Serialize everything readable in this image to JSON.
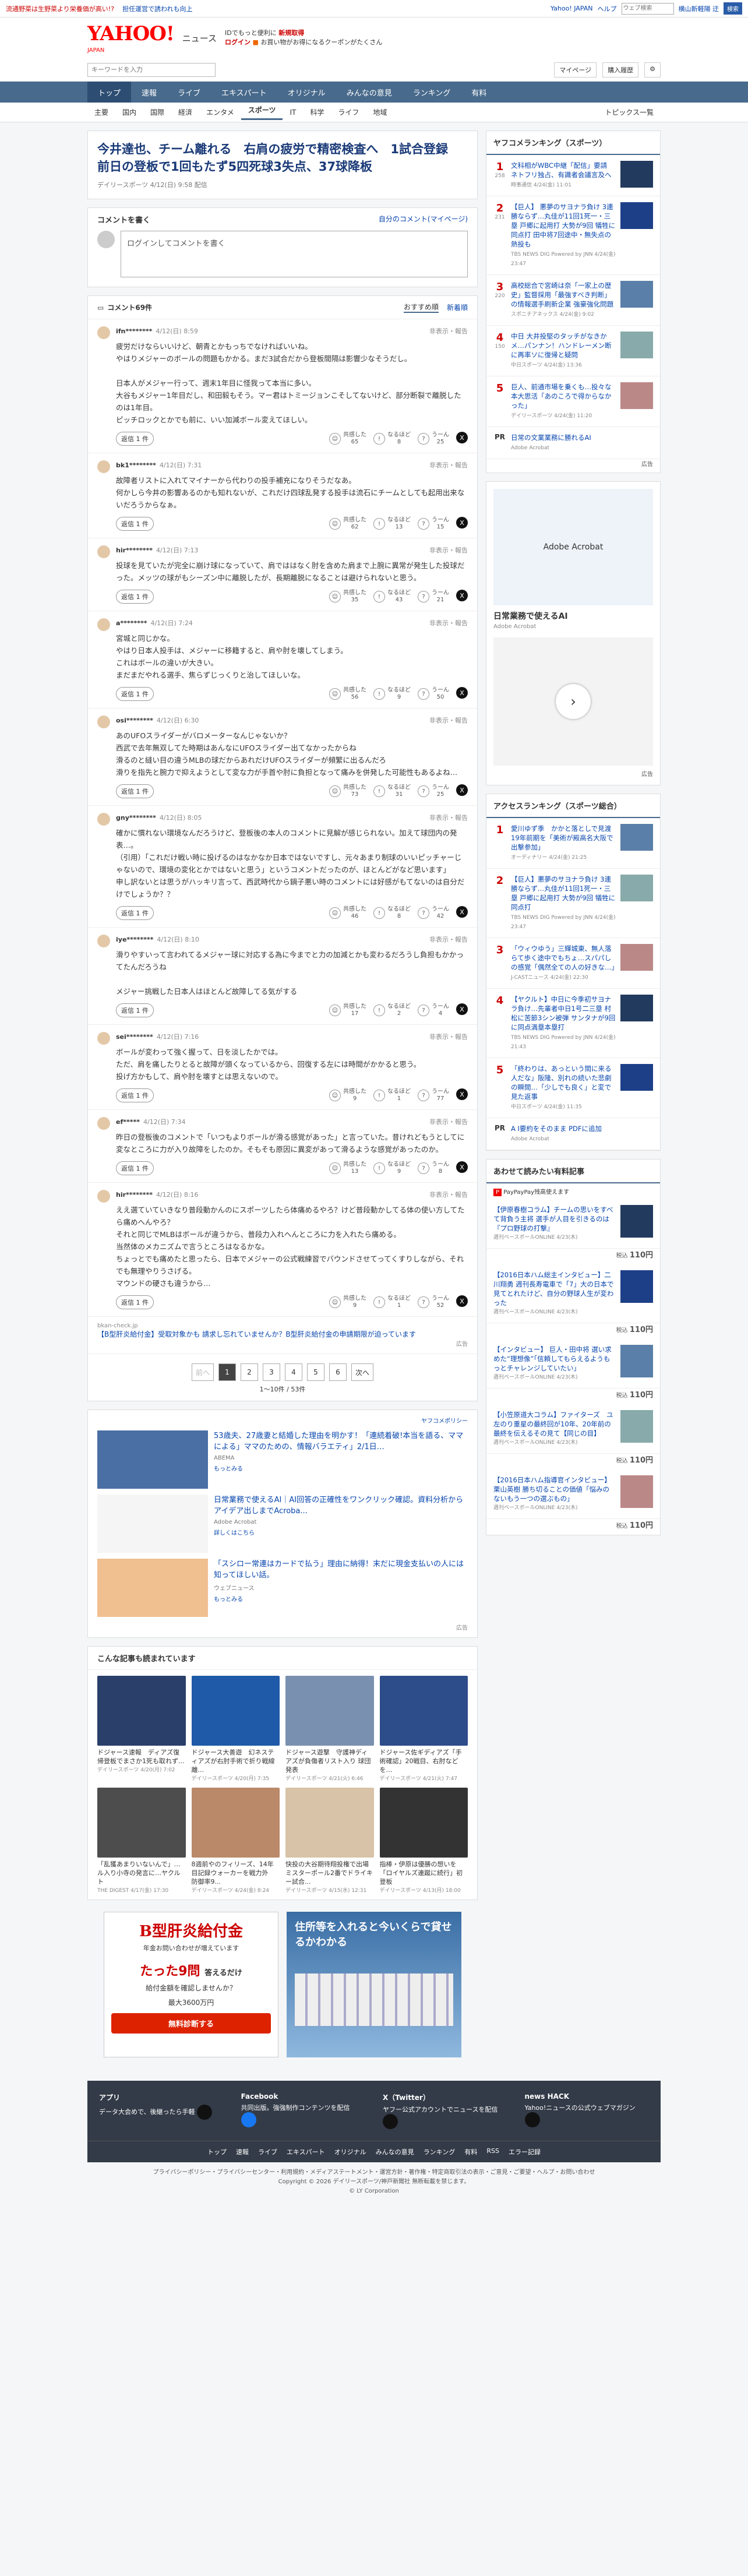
{
  "topbar": {
    "notice1": "流通野菜は生野菜より栄養価が高い!?",
    "notice2": "担任運営で誘われも向上",
    "yahoo_japan": "Yahoo! JAPAN",
    "help": "ヘルプ",
    "search_placeholder": "ウェブ検索",
    "location": "横山新軽陽 迂",
    "search_btn": "検索"
  },
  "header": {
    "logo": "YAHOO!",
    "logo_sub": "JAPAN",
    "service": "ニュース",
    "promo1": "IDでもっと便利に",
    "promo1b": "新規取得",
    "promo2": "ログイン",
    "promo2b": "お買い物がお得になるクーポンがたくさん"
  },
  "searchrow": {
    "placeholder": "キーワードを入力",
    "mypage": "マイページ",
    "purchase": "購入履歴"
  },
  "gnav": [
    "トップ",
    "速報",
    "ライブ",
    "エキスパート",
    "オリジナル",
    "みんなの意見",
    "ランキング",
    "有料"
  ],
  "subnav": [
    "主要",
    "国内",
    "国際",
    "経済",
    "エンタメ",
    "スポーツ",
    "IT",
    "科学",
    "ライフ",
    "地域"
  ],
  "subnav_topics": "トピックス一覧",
  "article": {
    "title": "今井達也、チーム離れる　右肩の疲労で精密検査へ　1試合登録　前日の登板で1回もたず5四死球3失点、37球降板",
    "meta": "デイリースポーツ 4/12(日) 9:58 配信"
  },
  "comment_write": {
    "title": "コメントを書く",
    "mine": "自分のコメント(マイページ)",
    "login": "ログインしてコメントを書く"
  },
  "sortbar": {
    "count": "コメント69件",
    "recommend": "おすすめ順",
    "newest": "新着順"
  },
  "comments": [
    {
      "user": "ifn********",
      "time": "4/12(日) 8:59",
      "report": "非表示・報告",
      "text": "疲労だけならいいけど、朝青とかもっちでなければいいね。\nやはりメジャーのボールの問題もかかる。まだ3試合だから登板間隔は影響少なそうだし。\n\n日本人がメジャー行って、週末1年目に怪我って本当に多い。\n大谷もメジャー1年目だし、和田毅もそう。マー君はトミージョンこそしてないけど、部分断裂で離脱したのは1年目。\nピッチロックとかでも前に、いい加減ボール変えてほしい。",
      "reply": "返信 1 件",
      "r1": "65",
      "r2": "8",
      "r3": "25"
    },
    {
      "user": "bk1********",
      "time": "4/12(日) 7:31",
      "report": "非表示・報告",
      "text": "故障者リストに入れてマイナーから代わりの投手補充になりそうだなあ。\n何かしら今井の影響あるのかも知れないが、これだけ四球乱発する投手は流石にチームとしても起用出来ないだろうからなぁ。",
      "reply": "返信 1 件",
      "r1": "62",
      "r2": "13",
      "r3": "15"
    },
    {
      "user": "hir********",
      "time": "4/12(日) 7:13",
      "report": "非表示・報告",
      "text": "投球を見ていたが完全に崩け球になっていて、肩でははなく肘を含めた肩まで上腕に異常が発生した投球だった。メッツの球がもシーズン中に離脱したが、長期離脱になることは避けられないと思う。",
      "reply": "返信 1 件",
      "r1": "35",
      "r2": "43",
      "r3": "21"
    },
    {
      "user": "a********",
      "time": "4/12(日) 7:24",
      "report": "非表示・報告",
      "text": "宮城と同じかな。\nやはり日本人投手は、メジャーに移籍すると、肩や肘を壊してしまう。\nこれはボールの違いが大きい。\nまだまだやれる選手、焦らずじっくりと治してほしいな。",
      "reply": "返信 1 件",
      "r1": "56",
      "r2": "9",
      "r3": "50"
    },
    {
      "user": "osi********",
      "time": "4/12(日) 6:30",
      "report": "非表示・報告",
      "text": "あのUFOスライダーがバロメーターなんじゃないか？\n西武で去年無双してた時期はあんなにUFOスライダー出てなかったからね\n滑るのと縫い目の違うMLBの球だからあれだけUFOスライダーが頻繁に出るんだろ\n滑りを指先と腕力で抑えようとして変な力が手首や肘に負担となって痛みを併発した可能性もあるよね…",
      "reply": "返信 1 件",
      "r1": "73",
      "r2": "31",
      "r3": "25"
    },
    {
      "user": "gny********",
      "time": "4/12(日) 8:05",
      "report": "非表示・報告",
      "text": "確かに慣れない環境なんだろうけど、登板後の本人のコメントに見解が感じられない。加えて球団内の発表…。\n（引用）「これだけ戦い時に投げるのはなかなか日本ではないですし、元々あまり制球のいいピッチャーじゃないので、環境の変化とかではないと思う」というコメントだったのが、ほとんどがなど思います」\n申し訳ないとは思うがハッキリ言って、西武時代から鍋子悪い時のコメントには好感がもてないのは自分だけでしょうか？？",
      "reply": "返信 1 件",
      "r1": "46",
      "r2": "8",
      "r3": "42"
    },
    {
      "user": "iye********",
      "time": "4/12(日) 8:10",
      "report": "非表示・報告",
      "text": "滑りやすいって言われてるメジャー球に対応する為に今までと力の加減とかも変わるだろうし負担もかかってたんだろうね\n\nメジャー挑戦した日本人はほとんど故障してる気がする",
      "reply": "返信 1 件",
      "r1": "17",
      "r2": "2",
      "r3": "4"
    },
    {
      "user": "sei********",
      "time": "4/12(日) 7:16",
      "report": "非表示・報告",
      "text": "ボールが変わって強く握って、日を淡したかでは。\nただ、肩を痛したりとると故障が頭くなっているから、回復する左には時間がかかると思う。\n投げ方かもして、肩や肘を壊すとは思えないので。",
      "reply": "返信 1 件",
      "r1": "9",
      "r2": "1",
      "r3": "77"
    },
    {
      "user": "ef*****",
      "time": "4/12(日) 7:34",
      "report": "非表示・報告",
      "text": "昨日の登板後のコメントで「いつもよりボールが滑る感覚があった」と言っていた。昔けれどもうとしてに変なところに力が入り故障をしたのか。そもそも原因に異変があって滑るような感覚があったのか。",
      "reply": "返信 1 件",
      "r1": "13",
      "r2": "9",
      "r3": "8"
    },
    {
      "user": "hir********",
      "time": "4/12(日) 8:16",
      "report": "非表示・報告",
      "text": "ええ選ていていきなり普段動かんのにスポーツしたら体痛めるやろ？けど普段動かしてる体の使い方してたら痛めへんやろ？\nそれと同じでMLBはボールが違うから、普段力入れへんところに力を入れたら痛める。\n当然体のメカニズムで言うところはなるかな。\nちょっとでも痛めたと思ったら、日本でメジャーの公式戦練習でバウンドさせてってくすりしながら、それでも無理やりうさげる。\nマウンドの硬さも違うから…",
      "reply": "返信 1 件",
      "r1": "9",
      "r2": "1",
      "r3": "52"
    }
  ],
  "reaction_labels": {
    "r1": "共感した",
    "r2": "なるほど",
    "r3": "うーん"
  },
  "inline_ad": {
    "src": "bkan-check.jp",
    "text": "【B型肝炎給付金】受取対象かも 請求し忘れていませんか？B型肝炎給付金の申請期限が迫っています",
    "tag": "広告"
  },
  "pager": {
    "prev": "前へ",
    "pages": [
      "1",
      "2",
      "3",
      "4",
      "5",
      "6"
    ],
    "next": "次へ",
    "info": "1〜10件 / 53件"
  },
  "sponsored": {
    "header": "ヤフコメポリシー",
    "items": [
      {
        "title": "53歳夫、27歳妻と結婚した理由を明かす！「連続着破!本当を語る、ママによる」ママのための、情報バラエティ」2/1日…",
        "src": "ABEMA",
        "more": "もっとみる"
      },
      {
        "title": "日常業務で使えるAI｜AI回答の正確性をワンクリック確認。資料分析からアイデア出しまでAcroba...",
        "src": "Adobe Acrobat",
        "more": "詳しくはこちら"
      },
      {
        "title": "「スシロー常連はカードで払う」理由に納得！末だに現金支払いの人には知ってほしい話。",
        "src": "ウェブニュース",
        "more": "もっとみる"
      }
    ],
    "tag": "広告"
  },
  "also": {
    "title": "こんな記事も読まれています",
    "items": [
      {
        "t": "ドジャース速報　ディアズ復帰登板でまさか1死も取れず...",
        "s": "デイリースポーツ 4/20(月) 7:02"
      },
      {
        "t": "ドジャース大善遊　幻ネスティアズが右肘手術で折り戦線離...",
        "s": "デイリースポーツ 4/20(月) 7:35"
      },
      {
        "t": "ドジャース遊撃　守護神ディアズが負傷者リスト入り 球団発表",
        "s": "デイリースポーツ 4/21(火) 6:46"
      },
      {
        "t": "ドジャース佐ギディアズ「手術確認」20戦目、右肘などを…",
        "s": "デイリースポーツ 4/21(火) 7:47"
      },
      {
        "t": "「乱獲あまりいないんで」…ル入り小寺の発言に…ヤクルト",
        "s": "THE DIGEST 4/17(金) 17:30"
      },
      {
        "t": "8週前やのフィリーズ、14年目記録ウォーカーを戦力外　防御率9...",
        "s": "デイリースポーツ 4/24(金) 8:24"
      },
      {
        "t": "快投の大谷期待翔投権で出場ミスターポール2番でドライキー試合...",
        "s": "デイリースポーツ 4/15(水) 12:31"
      },
      {
        "t": "指棒・伊原は優勝の想いを「ロイヤルズ連蹴に続行」初登板",
        "s": "デイリースポーツ 4/13(月) 18:00"
      }
    ]
  },
  "bigad": {
    "a1_title": "B型肝炎給付金",
    "a1_sub": "年金お問い合わせが増えています",
    "a1_big": "たった9問",
    "a1_sub2": "答えるだけ",
    "a1_sub3": "給付金額を確認しませんか？",
    "a1_amount": "最大3600万円",
    "a1_btn": "無料診断する",
    "a2_title": "住所等を入れると今いくらで貸せるかわかる"
  },
  "ranking": {
    "title": "ヤフコメランキング（スポーツ）",
    "items": [
      {
        "n": "1",
        "c": "258",
        "t": "文科相がWBC中継「配信」要請　ネトフリ独占、有識者会議言及へ",
        "s": "時事通信 4/24(金) 11:01"
      },
      {
        "n": "2",
        "c": "231",
        "t": "【巨人】 悪夢のサヨナラ負け 3連勝ならず…丸佳が11回1死一・三塁 戸郷に起用打 大勢が9回 犠牲に同点打 田中将7回途中・無失点の熱投も",
        "s": "TBS NEWS DIG Powered by JNN 4/24(金) 23:47"
      },
      {
        "n": "3",
        "c": "220",
        "t": "高校総合で宮崎は奈「一家上の歴史」監督採用「最強すべき判断」の情報選手刷新企業 強豪強化問題",
        "s": "スポニチアネックス 4/24(金) 9:02"
      },
      {
        "n": "4",
        "c": "150",
        "t": "中日 大井投堅のタッチがなきかメ…パンナン！ハンドレーメン断に再率ソに復帰と疑問",
        "s": "中日スポーツ 4/24(金) 13:36"
      },
      {
        "n": "5",
        "c": "",
        "t": "巨人、前通市場を乗くも…投々な本大思活「あのころで得からなかった」",
        "s": "デイリースポーツ 4/24(金) 11:20"
      }
    ],
    "pr": "日常の文業業務に勝れるAI",
    "pr_src": "Adobe Acrobat",
    "tag": "広告"
  },
  "side_ad": {
    "box": "Adobe Acrobat",
    "t": "日常業務で使えるAI",
    "s": "Adobe Acrobat",
    "tag": "広告"
  },
  "access": {
    "title": "アクセスランキング（スポーツ総合）",
    "items": [
      {
        "n": "1",
        "t": "愛川ゆず季　かかと落としで見渡19年前期を「美術が殿高名大阪で出撃参加」",
        "s": "オーディナリー 4/24(金) 21:25"
      },
      {
        "n": "2",
        "t": "【巨人】悪夢のサヨナラ負け 3連勝ならず…丸佳が11回1死一・三塁 戸郷に起用打 大勢が9回 犠牲に同点打",
        "s": "TBS NEWS DIG Powered by JNN 4/24(金) 23:47"
      },
      {
        "n": "3",
        "t": "「ウィウゆう」三輝城東、無人落らて歩く途中でもちょ…スパパしの感覚「偶然全ての人の好きな…」",
        "s": "J-CASTニュース 4/24(金) 22:30"
      },
      {
        "n": "4",
        "t": "【ヤクルト】中日に今季初サヨナラ負け…先輩者中日1号二三塁 村松に苦節3シン被弾 サンタナが9回に同点満塁本塁打",
        "s": "TBS NEWS DIG Powered by JNN 4/24(金) 21:43"
      },
      {
        "n": "5",
        "t": "「終わりは、あっという間に来る人だな」阪隆、別れの続いた悲劇の瞬間…「少しでも良く」と変で見た返事",
        "s": "中日スポーツ 4/24(金) 11:35"
      }
    ],
    "pr": "A I要約をそのまま PDFに追加",
    "pr_src": "Adobe Acrobat"
  },
  "recommend": {
    "title": "あわせて読みたい有料記事",
    "tag": "PayPayPay残高使えます",
    "items": [
      {
        "t": "【伊原春樹コラム】チームの思いをすべて背負う主将 選手が人目を引きるのは『プロ野球の打撃』",
        "s": "週刊ベースボールONLINE 4/23(木)",
        "p": "110円"
      },
      {
        "t": "【2016日本ハム総主インタビュー】二川翔勇 週刊長寿電車で「7」大の日本で見てとれたけど、自分の野球人生が変わった",
        "s": "週刊ベースボールONLINE 4/23(木)",
        "p": "110円"
      },
      {
        "t": "【インタビュー】 巨人・田中将 選い求めた“理想像”「信頼してもらえるようもっとチャレンジしていたい」",
        "s": "週刊ベースボールONLINE 4/23(木)",
        "p": "110円"
      },
      {
        "t": "【小笠原道大コラム】ファイターズ　ユ左のり重星の最終回が10年、20年前の最終を伝えるその見て【同じの目】",
        "s": "週刊ベースボールONLINE 4/23(木)",
        "p": "110円"
      },
      {
        "t": "【2016日本ハム指導官インタビュー】栗山英樹 勝ち切ることの価値「悩みのないもう一つの選ぶもの」",
        "s": "週刊ベースボールONLINE 4/23(木)",
        "p": "110円"
      }
    ],
    "price_label": "税込"
  },
  "footer": {
    "apps": [
      {
        "t": "アプリ",
        "s": "データ大会めで、後継ったら手軽"
      },
      {
        "t": "Facebook",
        "s": "共同出版。強強制作コンテンツを配信"
      },
      {
        "t": "X（Twitter）",
        "s": "ヤフー公式アカウントでニュースを配信"
      },
      {
        "t": "news HACK",
        "s": "Yahoo!ニュースの公式ウェブマガジン"
      }
    ],
    "nav": [
      "トップ",
      "速報",
      "ライブ",
      "エキスパート",
      "オリジナル",
      "みんなの意見",
      "ランキング",
      "有料",
      "RSS",
      "エラー記録"
    ],
    "legal1": "プライバシーポリシー・プライバシーセンター・利用規約・メディアステートメント・運営方針・著作権・特定商取引法の表示・ご意見・ご要望・ヘルプ・お問い合わせ",
    "legal2": "Copyright © 2026 デイリースポーツ/神戸新聞社 無断転載を禁じます。",
    "legal3": "© LY Corporation"
  }
}
